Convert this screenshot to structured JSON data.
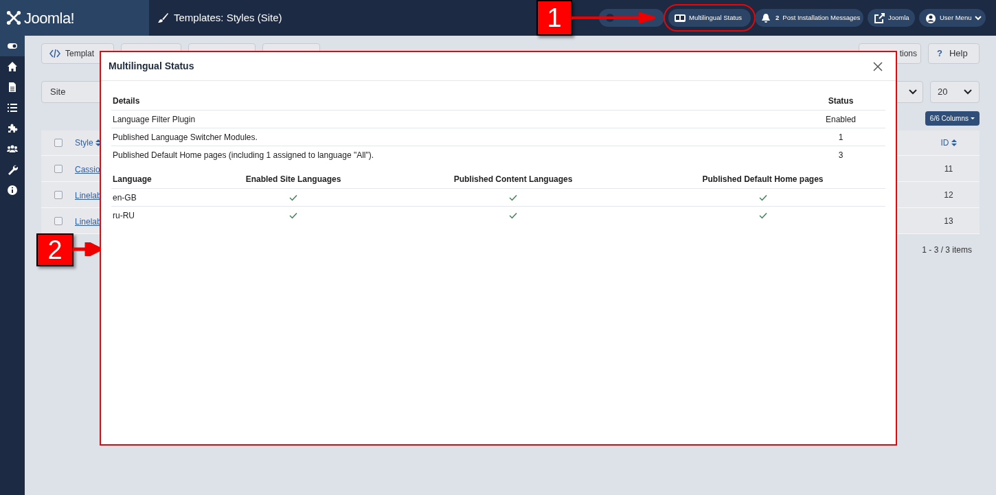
{
  "header": {
    "logo": "Joomla!",
    "page_title": "Templates: Styles (Site)",
    "buttons": [
      {
        "kind": "icon_only"
      },
      {
        "kind": "language",
        "label": "Multilingual Status",
        "highlighted": true
      },
      {
        "kind": "bell",
        "count": "2",
        "label": "Post Installation Messages"
      },
      {
        "kind": "external",
        "label": "Joomla"
      },
      {
        "kind": "user",
        "label": "User Menu"
      }
    ]
  },
  "sidebar": {
    "items": [
      {
        "kind": "toggle",
        "selected": true
      },
      {
        "kind": "home",
        "selected": false
      },
      {
        "kind": "file",
        "selected": false
      },
      {
        "kind": "list",
        "selected": false
      },
      {
        "kind": "puzzle",
        "selected": false
      },
      {
        "kind": "users",
        "selected": false
      },
      {
        "kind": "wrench",
        "selected": false
      },
      {
        "kind": "info",
        "selected": false
      }
    ]
  },
  "toolbar": {
    "buttons": [
      {
        "label": "Templat"
      }
    ],
    "right_buttons": [
      {
        "kind": "options",
        "label": "tions"
      },
      {
        "kind": "help",
        "icon": "?",
        "label": "Help"
      }
    ]
  },
  "filters": {
    "client": "Site",
    "limit": "20"
  },
  "columns_button": "6/6 Columns",
  "table": {
    "columns": [
      "Style",
      "ID"
    ],
    "header_checked": false,
    "rows": [
      {
        "style": "Cassio",
        "id": "11",
        "checked": false
      },
      {
        "style": "Linelab",
        "id": "12",
        "checked": false
      },
      {
        "style": "Linelab",
        "id": "13",
        "checked": false
      }
    ]
  },
  "pagination": "1 - 3 / 3 items",
  "modal": {
    "title": "Multilingual Status",
    "details": {
      "columns": [
        "Details",
        "Status"
      ],
      "rows": [
        {
          "label": "Language Filter Plugin",
          "value": "Enabled"
        },
        {
          "label": "Published Language Switcher Modules.",
          "value": "1"
        },
        {
          "label": "Published Default Home pages (including 1 assigned to language \"All\").",
          "value": "3"
        }
      ]
    },
    "languages": {
      "columns": [
        "Language",
        "Enabled Site Languages",
        "Published Content Languages",
        "Published Default Home pages"
      ],
      "rows": [
        {
          "language": "en-GB",
          "site_enabled": true,
          "content_published": true,
          "home_published": true
        },
        {
          "language": "ru-RU",
          "site_enabled": true,
          "content_published": true,
          "home_published": true
        }
      ]
    }
  },
  "annotations": [
    {
      "kind": "header",
      "label": "1"
    },
    {
      "kind": "modal",
      "label": "2"
    }
  ]
}
